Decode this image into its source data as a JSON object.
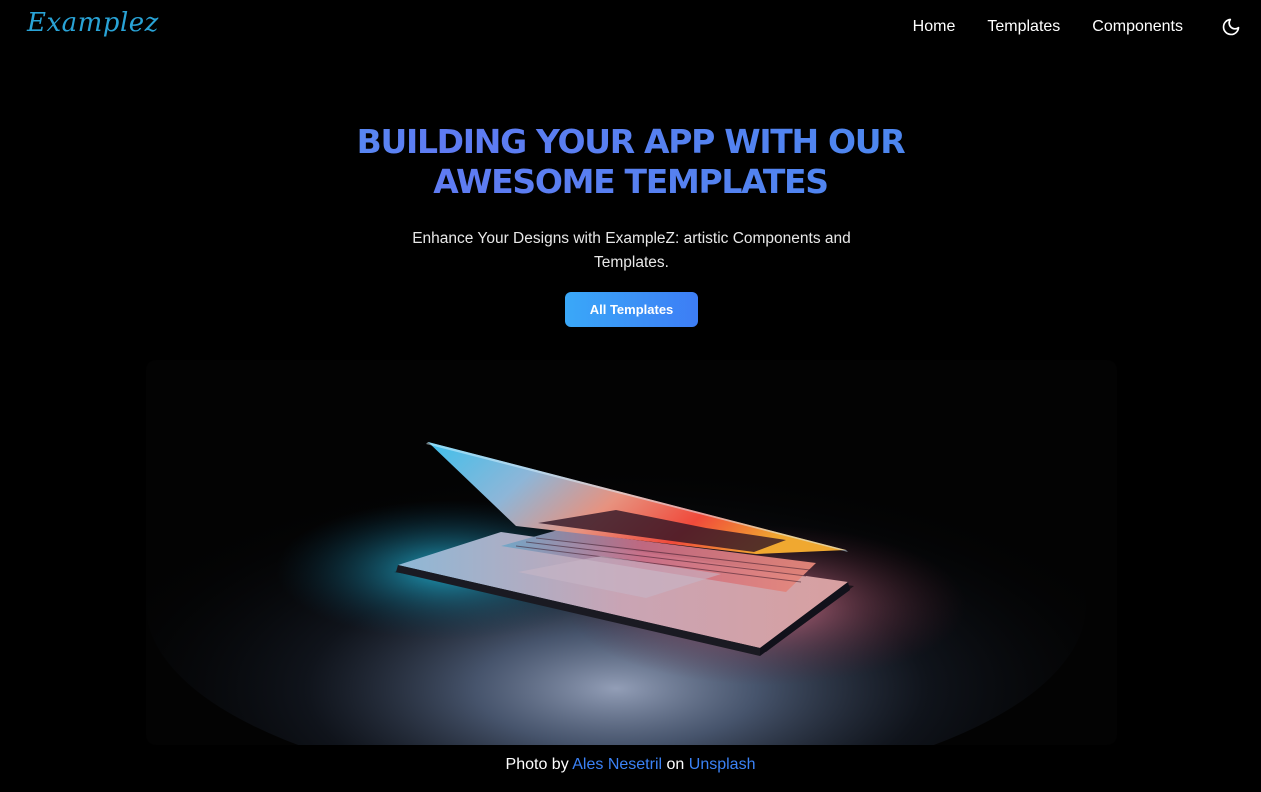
{
  "brand": {
    "logo_text": "Examplez",
    "logo_color": "#29a3d6"
  },
  "nav": {
    "links": [
      {
        "label": "Home"
      },
      {
        "label": "Templates"
      },
      {
        "label": "Components"
      }
    ],
    "theme_toggle_icon": "moon-icon"
  },
  "hero": {
    "title_line1": "BUILDING YOUR APP WITH OUR",
    "title_line2": "AWESOME TEMPLATES",
    "subtitle": "Enhance Your Designs with ExampleZ: artistic Components and Templates.",
    "cta_label": "All Templates",
    "image_subject": "half-open-laptop-glowing-screen"
  },
  "credit": {
    "prefix": "Photo by",
    "author": "Ales Nesetril",
    "middle": "on",
    "source": "Unsplash"
  },
  "colors": {
    "background": "#000000",
    "accent_gradient_start": "#38b6f5",
    "accent_gradient_end": "#3d7df5",
    "link": "#3b82f6"
  }
}
